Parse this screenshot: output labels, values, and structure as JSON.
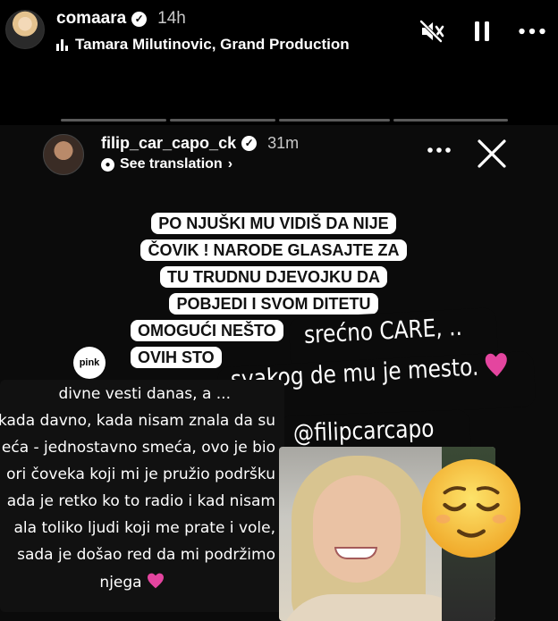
{
  "outer": {
    "username": "comaara",
    "time": "14h",
    "music": "Tamara Milutinovic, Grand Production"
  },
  "inner": {
    "username": "filip_car_capo_ck",
    "time": "31m",
    "see_translation": "See translation"
  },
  "quote_lines": [
    "PO NJUŠKI MU VIDIŠ DA NIJE",
    "ČOVIK !  NARODE GLASAJTE ZA",
    "TU TRUDNU DJEVOJKU DA",
    "POBJEDI I SVOM DITETU",
    "OMOGUĆI NEŠTO",
    "OVIH STO"
  ],
  "overlay": {
    "line1": "srećno CARE, ..",
    "line2": "svakog de mu je mesto.",
    "mention": "@filipcarcapo"
  },
  "logo_text": "pink",
  "left_lines": [
    "divne vesti danas, a ...",
    "kada davno, kada nisam znala da su",
    "eća - jednostavno smeća, ovo je bio",
    "ori čoveka koji mi je pružio podršku",
    "ada je retko ko to radio i kad nisam",
    "ala toliko ljudi koji me prate i vole,",
    "sada je došao red da mi podržimo",
    "njega"
  ],
  "colors": {
    "heart": "#e4459f",
    "emoji": "#f7c63a"
  },
  "icons": [
    "verified-icon",
    "music-bars-icon",
    "mute-icon",
    "pause-icon",
    "more-icon",
    "close-icon",
    "translate-icon",
    "heart-icon",
    "relieved-face-emoji"
  ]
}
